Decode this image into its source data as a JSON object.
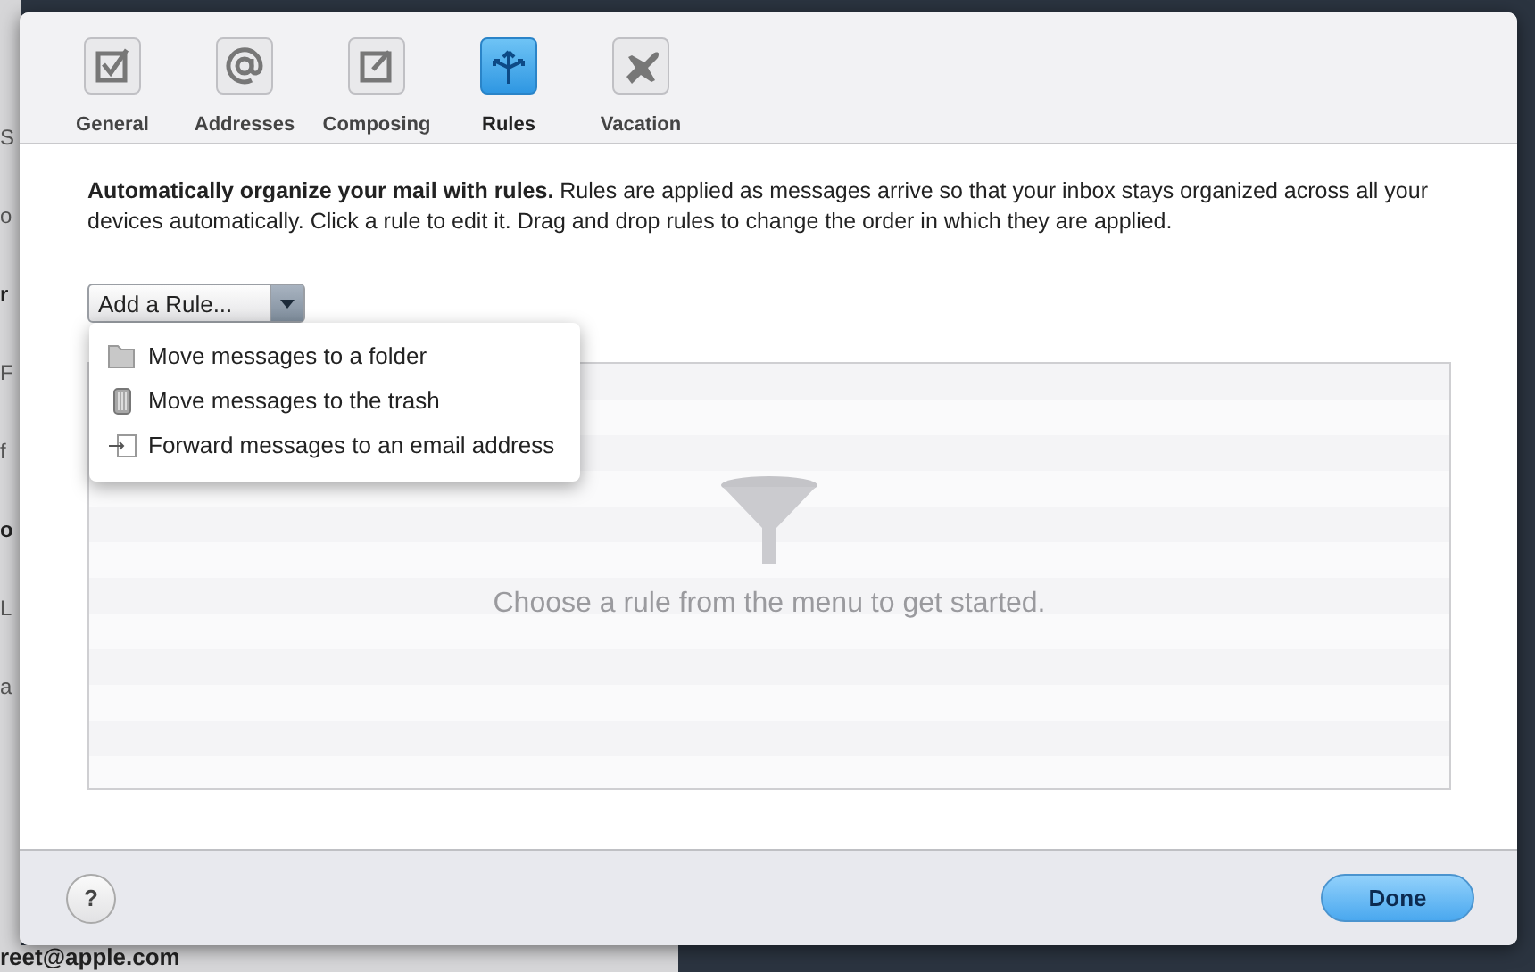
{
  "background_list": [
    {
      "text": "S",
      "bold": false
    },
    {
      "text": "o",
      "bold": false
    },
    {
      "text": "r",
      "bold": true
    },
    {
      "text": "F",
      "bold": false
    },
    {
      "text": "f",
      "bold": false
    },
    {
      "text": "o",
      "bold": true
    },
    {
      "text": "L",
      "bold": false
    },
    {
      "text": "a",
      "bold": false
    }
  ],
  "background_footer": {
    "email": "reet@apple.com"
  },
  "tabs": [
    {
      "label": "General",
      "selected": false
    },
    {
      "label": "Addresses",
      "selected": false
    },
    {
      "label": "Composing",
      "selected": false
    },
    {
      "label": "Rules",
      "selected": true
    },
    {
      "label": "Vacation",
      "selected": false
    }
  ],
  "description": "**Automatically organize your mail with rules.** Rules are applied as messages arrive so that your inbox stays organized across all your devices automatically. Click a rule to edit it. Drag and drop rules to change the order in which they are applied.",
  "add_rule": {
    "label": "Add a Rule...",
    "expanded": true
  },
  "menu_items": [
    {
      "kind": "folder",
      "label": "Move messages to a folder"
    },
    {
      "kind": "trash",
      "label": "Move messages to the trash"
    },
    {
      "kind": "forward",
      "label": "Forward messages to an email address"
    }
  ],
  "empty_message": "Choose a rule from the menu to get started.",
  "footer": {
    "help": "?",
    "done": "Done"
  }
}
